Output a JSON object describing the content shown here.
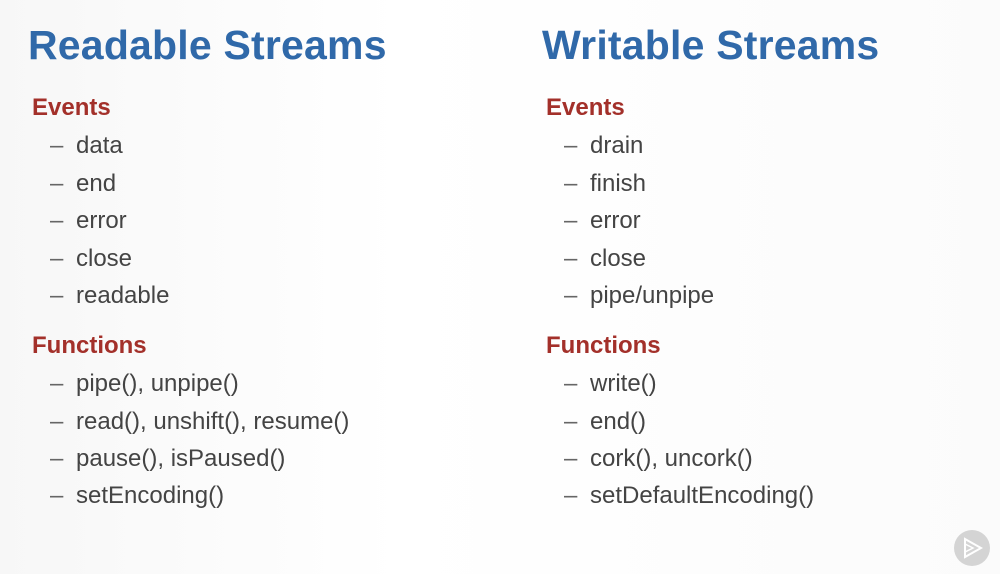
{
  "left": {
    "title": "Readable Streams",
    "events_heading": "Events",
    "events": [
      "data",
      "end",
      "error",
      "close",
      "readable"
    ],
    "functions_heading": "Functions",
    "functions": [
      "pipe(), unpipe()",
      "read(), unshift(), resume()",
      "pause(), isPaused()",
      "setEncoding()"
    ]
  },
  "right": {
    "title": "Writable Streams",
    "events_heading": "Events",
    "events": [
      "drain",
      "finish",
      "error",
      "close",
      "pipe/unpipe"
    ],
    "functions_heading": "Functions",
    "functions": [
      "write()",
      "end()",
      "cork(), uncork()",
      "setDefaultEncoding()"
    ]
  },
  "bullet": "–",
  "logo_icon": "play-icon"
}
